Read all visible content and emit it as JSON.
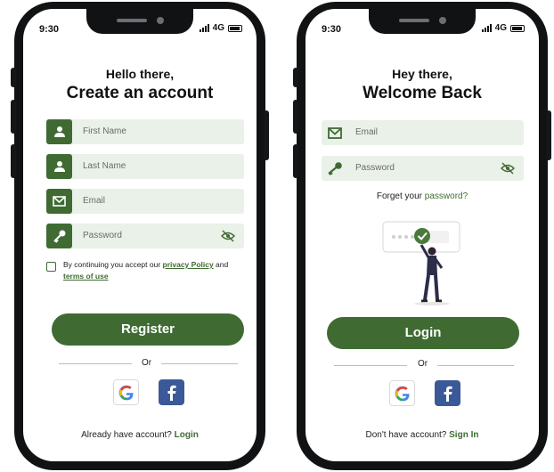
{
  "colors": {
    "accent": "#3f6b33",
    "field_bg": "#eaf1e8",
    "facebook": "#3b5998"
  },
  "register_screen": {
    "status": {
      "time": "9:30",
      "network": "4G"
    },
    "greeting": "Hello there,",
    "heading": "Create an account",
    "fields": [
      {
        "icon": "user-icon",
        "placeholder": "First Name"
      },
      {
        "icon": "user-icon",
        "placeholder": "Last Name"
      },
      {
        "icon": "mail-icon",
        "placeholder": "Email"
      },
      {
        "icon": "key-icon",
        "placeholder": "Password"
      }
    ],
    "terms": {
      "prefix": "By continuing you accept our ",
      "policy_link": "privacy Policy",
      "and": " and",
      "terms_link": "terms of use"
    },
    "register_button": "Register",
    "divider": "Or",
    "footer": {
      "text": "Already have account? ",
      "link": "Login"
    }
  },
  "login_screen": {
    "status": {
      "time": "9:30",
      "network": "4G"
    },
    "greeting": "Hey there,",
    "heading": "Welcome Back",
    "fields": [
      {
        "icon": "mail-icon",
        "placeholder": "Email"
      },
      {
        "icon": "key-icon",
        "placeholder": "Password"
      }
    ],
    "forgot": {
      "text": "Forget your ",
      "link": "password?"
    },
    "login_button": "Login",
    "divider": "Or",
    "footer": {
      "text": "Don't have account? ",
      "link": "Sign In"
    }
  }
}
